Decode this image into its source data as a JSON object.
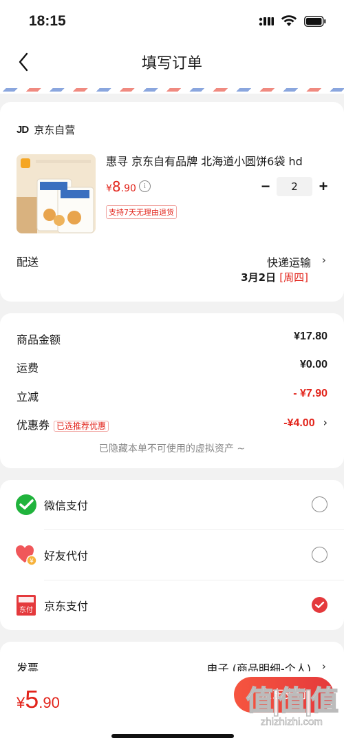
{
  "status_bar": {
    "time": "18:15"
  },
  "nav": {
    "title": "填写订单",
    "back_icon": "chevron-left-icon"
  },
  "colors": {
    "accent": "#e2231a",
    "airmail_red": "#f08a80",
    "airmail_blue": "#8aa6de",
    "wechat_green": "#20b33c"
  },
  "order": {
    "shop_logo": "JD",
    "shop_name": "京东自营",
    "product": {
      "name": "惠寻 京东自有品牌 北海道小圆饼6袋 hd",
      "price_symbol": "¥",
      "price_int": "8",
      "price_dec": ".90",
      "return_badge": "支持7天无理由退货",
      "quantity": "2",
      "minus": "−",
      "plus": "+",
      "image_label": "北海道小圆饼",
      "brand_label": "惠寻"
    },
    "delivery": {
      "label": "配送",
      "method": "快递运输",
      "date": "3月2日",
      "weekday": "[周四]"
    }
  },
  "amounts": {
    "rows": [
      {
        "label": "商品金额",
        "value": "¥17.80"
      },
      {
        "label": "运费",
        "value": "¥0.00"
      },
      {
        "label": "立减",
        "value": "- ¥7.90"
      },
      {
        "label": "优惠券",
        "tag": "已选推荐优惠",
        "value": "-¥4.00"
      }
    ],
    "hidden_note": "已隐藏本单不可使用的虚拟资产 ~"
  },
  "payment": {
    "options": [
      {
        "label": "微信支付",
        "icon": "wechat-pay-icon",
        "selected": false
      },
      {
        "label": "好友代付",
        "icon": "friend-pay-heart-icon",
        "selected": false
      },
      {
        "label": "京东支付",
        "icon": "jd-pay-icon",
        "icon_text": "东付",
        "selected": true
      }
    ]
  },
  "invoice": {
    "label": "发票",
    "value": "电子 (商品明细-个人)"
  },
  "footer": {
    "total_symbol": "¥",
    "total_int": "5",
    "total_dec": ".90",
    "pay_button": "京东支付",
    "watermark": "值|值|值",
    "watermark_url": "zhizhizhi.com"
  }
}
